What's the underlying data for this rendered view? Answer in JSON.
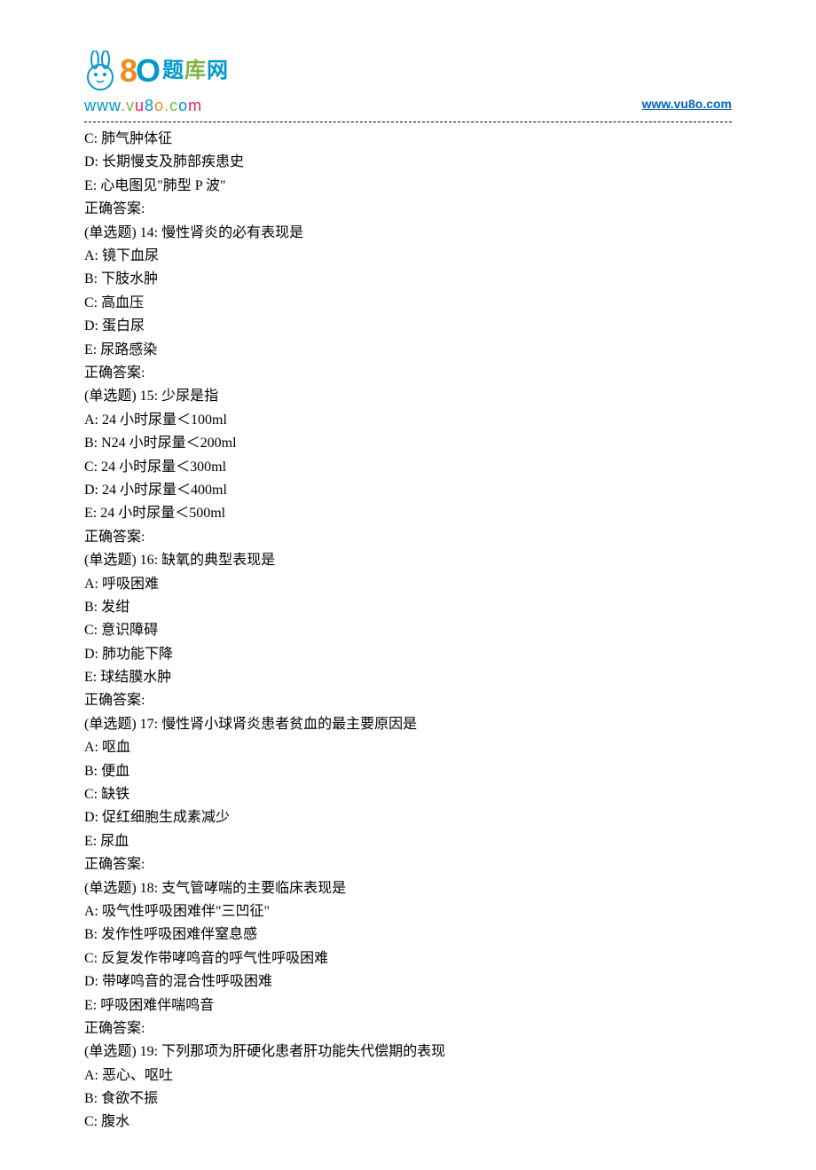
{
  "header": {
    "logo_cn_chars": [
      "题",
      "库",
      "网"
    ],
    "logo_url_parts": [
      "w",
      "w",
      "w",
      ".",
      "v",
      "u",
      "8",
      "o",
      ".",
      "c",
      "o",
      "m"
    ],
    "link_text": "www.vu8o.com"
  },
  "lines": [
    "C: 肺气肿体征",
    "D: 长期慢支及肺部疾患史",
    "E: 心电图见\"肺型 P 波\"",
    "正确答案:",
    "(单选题) 14: 慢性肾炎的必有表现是",
    "A: 镜下血尿",
    "B: 下肢水肿",
    "C: 高血压",
    "D: 蛋白尿",
    "E: 尿路感染",
    "正确答案:",
    "(单选题) 15: 少尿是指",
    "A: 24 小时尿量＜100ml",
    "B: N24 小时尿量＜200ml",
    "C: 24 小时尿量＜300ml",
    "D: 24 小时尿量＜400ml",
    "E: 24 小时尿量＜500ml",
    "正确答案:",
    "(单选题) 16: 缺氧的典型表现是",
    "A: 呼吸困难",
    "B: 发绀",
    "C: 意识障碍",
    "D: 肺功能下降",
    "E: 球结膜水肿",
    "正确答案:",
    "(单选题) 17: 慢性肾小球肾炎患者贫血的最主要原因是",
    "A: 呕血",
    "B: 便血",
    "C: 缺铁",
    "D: 促红细胞生成素减少",
    "E: 尿血",
    "正确答案:",
    "(单选题) 18: 支气管哮喘的主要临床表现是",
    "A: 吸气性呼吸困难伴\"三凹征\"",
    "B: 发作性呼吸困难伴窒息感",
    "C: 反复发作带哮鸣音的呼气性呼吸困难",
    "D: 带哮鸣音的混合性呼吸困难",
    "E: 呼吸困难伴喘鸣音",
    "正确答案:",
    "(单选题) 19: 下列那项为肝硬化患者肝功能失代偿期的表现",
    "A: 恶心、呕吐",
    "B: 食欲不振",
    "C: 腹水"
  ]
}
